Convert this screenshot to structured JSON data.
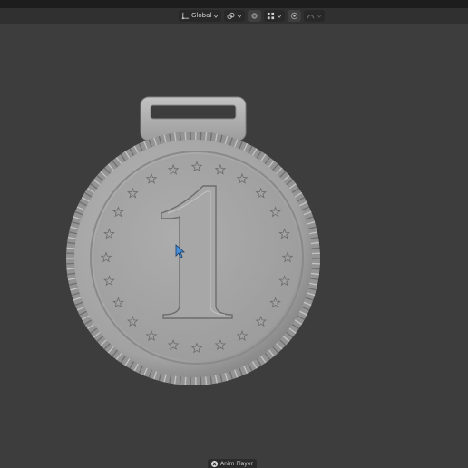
{
  "header": {
    "transform_orientation": {
      "label": "Global",
      "icon": "transform-orientation-icon"
    },
    "pivot": {
      "icon": "link-icon"
    },
    "snapping": {
      "icon": "snap-icon"
    },
    "snap_grid": {
      "icon": "grid-icon"
    },
    "proportional_editing": {
      "icon": "proportional-edit-icon"
    },
    "falloff": {
      "icon": "falloff-curve-icon"
    }
  },
  "viewport": {
    "object": "medal-coin",
    "embossed_numeral": "1",
    "star_count": 24,
    "cursor": "mouse-pointer-icon"
  },
  "statusbar": {
    "label": "Anim Player",
    "icon": "close-icon"
  },
  "colors": {
    "viewport_bg": "#3d3d3d",
    "header_bg": "#303030",
    "cursor_blue": "#4a90d9"
  }
}
